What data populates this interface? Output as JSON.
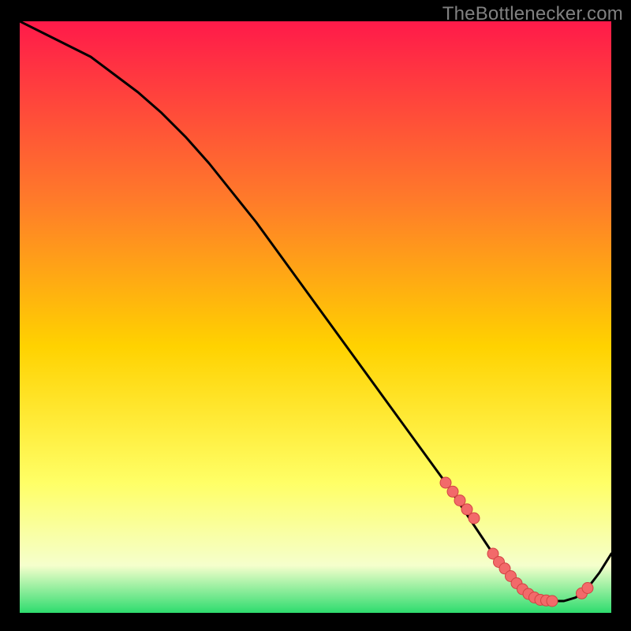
{
  "watermark": "TheBottlenecker.com",
  "colors": {
    "background": "#000000",
    "gradient_top": "#ff1a4a",
    "gradient_upper_mid": "#ff7a2a",
    "gradient_mid": "#ffd200",
    "gradient_lower_mid": "#ffff66",
    "gradient_pale": "#f5ffcc",
    "gradient_bottom": "#2edc6e",
    "curve": "#000000",
    "marker_fill": "#f26a6a",
    "marker_stroke": "#d24343"
  },
  "chart_data": {
    "type": "line",
    "title": "",
    "xlabel": "",
    "ylabel": "",
    "xlim": [
      0,
      100
    ],
    "ylim": [
      0,
      100
    ],
    "curve": {
      "x": [
        0,
        4,
        8,
        12,
        16,
        20,
        24,
        28,
        32,
        36,
        40,
        44,
        48,
        52,
        56,
        60,
        64,
        68,
        72,
        74,
        76,
        78,
        80,
        82,
        84,
        86,
        88,
        90,
        92,
        94,
        96,
        98,
        100
      ],
      "y": [
        100,
        98,
        96,
        94,
        91,
        88,
        84.5,
        80.5,
        76,
        71,
        66,
        60.5,
        55,
        49.5,
        44,
        38.5,
        33,
        27.5,
        22,
        19,
        16,
        13,
        10,
        7.5,
        5,
        3.2,
        2.2,
        2,
        2,
        2.6,
        4.2,
        6.8,
        10
      ]
    },
    "markers": {
      "groups": [
        {
          "x": [
            72,
            73.2,
            74.4,
            75.6,
            76.8
          ],
          "y": [
            22,
            20.5,
            19,
            17.5,
            16
          ]
        },
        {
          "x": [
            80,
            81,
            82,
            83,
            84,
            85,
            86,
            87,
            88,
            89,
            90
          ],
          "y": [
            10,
            8.6,
            7.5,
            6.2,
            5,
            4,
            3.2,
            2.6,
            2.2,
            2.1,
            2
          ]
        },
        {
          "x": [
            95,
            96
          ],
          "y": [
            3.3,
            4.2
          ]
        }
      ]
    }
  }
}
